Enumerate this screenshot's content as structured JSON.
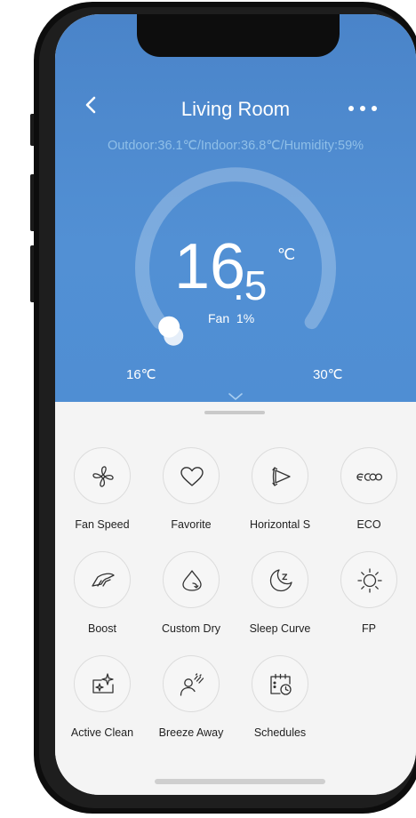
{
  "header": {
    "title": "Living Room",
    "status": "Outdoor:36.1℃/Indoor:36.8℃/Humidity:59%"
  },
  "thermostat": {
    "temp_int": "16",
    "temp_dec": ".5",
    "unit": "℃",
    "fan": "Fan  1%",
    "min_label": "16℃",
    "max_label": "30℃",
    "setpoint_fraction": 0.036
  },
  "features": [
    {
      "label": "Fan Speed",
      "icon": "fan-icon"
    },
    {
      "label": "Favorite",
      "icon": "heart-icon"
    },
    {
      "label": "Horizontal S",
      "icon": "horizontal-swing-icon"
    },
    {
      "label": "ECO",
      "icon": "eco-icon"
    },
    {
      "label": "Boost",
      "icon": "boost-icon"
    },
    {
      "label": "Custom Dry",
      "icon": "custom-dry-icon"
    },
    {
      "label": "Sleep Curve",
      "icon": "sleep-curve-icon"
    },
    {
      "label": "FP",
      "icon": "sun-icon"
    },
    {
      "label": "Active Clean",
      "icon": "active-clean-icon"
    },
    {
      "label": "Breeze Away",
      "icon": "breeze-away-icon"
    },
    {
      "label": "Schedules",
      "icon": "schedule-icon"
    }
  ],
  "colors": {
    "header_bg": "#4a86cc",
    "panel_bg": "#f4f4f4",
    "status_text": "#8fbfe8"
  }
}
